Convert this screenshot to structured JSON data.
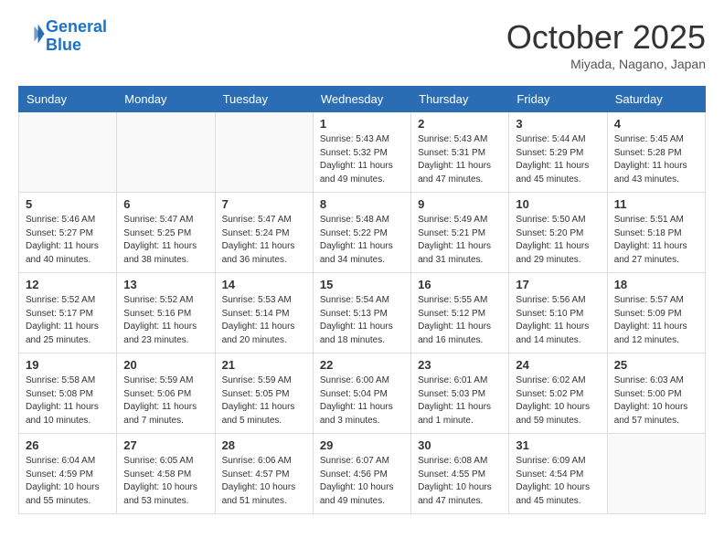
{
  "header": {
    "logo_line1": "General",
    "logo_line2": "Blue",
    "month": "October 2025",
    "location": "Miyada, Nagano, Japan"
  },
  "weekdays": [
    "Sunday",
    "Monday",
    "Tuesday",
    "Wednesday",
    "Thursday",
    "Friday",
    "Saturday"
  ],
  "weeks": [
    [
      {
        "day": "",
        "info": ""
      },
      {
        "day": "",
        "info": ""
      },
      {
        "day": "",
        "info": ""
      },
      {
        "day": "1",
        "info": "Sunrise: 5:43 AM\nSunset: 5:32 PM\nDaylight: 11 hours\nand 49 minutes."
      },
      {
        "day": "2",
        "info": "Sunrise: 5:43 AM\nSunset: 5:31 PM\nDaylight: 11 hours\nand 47 minutes."
      },
      {
        "day": "3",
        "info": "Sunrise: 5:44 AM\nSunset: 5:29 PM\nDaylight: 11 hours\nand 45 minutes."
      },
      {
        "day": "4",
        "info": "Sunrise: 5:45 AM\nSunset: 5:28 PM\nDaylight: 11 hours\nand 43 minutes."
      }
    ],
    [
      {
        "day": "5",
        "info": "Sunrise: 5:46 AM\nSunset: 5:27 PM\nDaylight: 11 hours\nand 40 minutes."
      },
      {
        "day": "6",
        "info": "Sunrise: 5:47 AM\nSunset: 5:25 PM\nDaylight: 11 hours\nand 38 minutes."
      },
      {
        "day": "7",
        "info": "Sunrise: 5:47 AM\nSunset: 5:24 PM\nDaylight: 11 hours\nand 36 minutes."
      },
      {
        "day": "8",
        "info": "Sunrise: 5:48 AM\nSunset: 5:22 PM\nDaylight: 11 hours\nand 34 minutes."
      },
      {
        "day": "9",
        "info": "Sunrise: 5:49 AM\nSunset: 5:21 PM\nDaylight: 11 hours\nand 31 minutes."
      },
      {
        "day": "10",
        "info": "Sunrise: 5:50 AM\nSunset: 5:20 PM\nDaylight: 11 hours\nand 29 minutes."
      },
      {
        "day": "11",
        "info": "Sunrise: 5:51 AM\nSunset: 5:18 PM\nDaylight: 11 hours\nand 27 minutes."
      }
    ],
    [
      {
        "day": "12",
        "info": "Sunrise: 5:52 AM\nSunset: 5:17 PM\nDaylight: 11 hours\nand 25 minutes."
      },
      {
        "day": "13",
        "info": "Sunrise: 5:52 AM\nSunset: 5:16 PM\nDaylight: 11 hours\nand 23 minutes."
      },
      {
        "day": "14",
        "info": "Sunrise: 5:53 AM\nSunset: 5:14 PM\nDaylight: 11 hours\nand 20 minutes."
      },
      {
        "day": "15",
        "info": "Sunrise: 5:54 AM\nSunset: 5:13 PM\nDaylight: 11 hours\nand 18 minutes."
      },
      {
        "day": "16",
        "info": "Sunrise: 5:55 AM\nSunset: 5:12 PM\nDaylight: 11 hours\nand 16 minutes."
      },
      {
        "day": "17",
        "info": "Sunrise: 5:56 AM\nSunset: 5:10 PM\nDaylight: 11 hours\nand 14 minutes."
      },
      {
        "day": "18",
        "info": "Sunrise: 5:57 AM\nSunset: 5:09 PM\nDaylight: 11 hours\nand 12 minutes."
      }
    ],
    [
      {
        "day": "19",
        "info": "Sunrise: 5:58 AM\nSunset: 5:08 PM\nDaylight: 11 hours\nand 10 minutes."
      },
      {
        "day": "20",
        "info": "Sunrise: 5:59 AM\nSunset: 5:06 PM\nDaylight: 11 hours\nand 7 minutes."
      },
      {
        "day": "21",
        "info": "Sunrise: 5:59 AM\nSunset: 5:05 PM\nDaylight: 11 hours\nand 5 minutes."
      },
      {
        "day": "22",
        "info": "Sunrise: 6:00 AM\nSunset: 5:04 PM\nDaylight: 11 hours\nand 3 minutes."
      },
      {
        "day": "23",
        "info": "Sunrise: 6:01 AM\nSunset: 5:03 PM\nDaylight: 11 hours\nand 1 minute."
      },
      {
        "day": "24",
        "info": "Sunrise: 6:02 AM\nSunset: 5:02 PM\nDaylight: 10 hours\nand 59 minutes."
      },
      {
        "day": "25",
        "info": "Sunrise: 6:03 AM\nSunset: 5:00 PM\nDaylight: 10 hours\nand 57 minutes."
      }
    ],
    [
      {
        "day": "26",
        "info": "Sunrise: 6:04 AM\nSunset: 4:59 PM\nDaylight: 10 hours\nand 55 minutes."
      },
      {
        "day": "27",
        "info": "Sunrise: 6:05 AM\nSunset: 4:58 PM\nDaylight: 10 hours\nand 53 minutes."
      },
      {
        "day": "28",
        "info": "Sunrise: 6:06 AM\nSunset: 4:57 PM\nDaylight: 10 hours\nand 51 minutes."
      },
      {
        "day": "29",
        "info": "Sunrise: 6:07 AM\nSunset: 4:56 PM\nDaylight: 10 hours\nand 49 minutes."
      },
      {
        "day": "30",
        "info": "Sunrise: 6:08 AM\nSunset: 4:55 PM\nDaylight: 10 hours\nand 47 minutes."
      },
      {
        "day": "31",
        "info": "Sunrise: 6:09 AM\nSunset: 4:54 PM\nDaylight: 10 hours\nand 45 minutes."
      },
      {
        "day": "",
        "info": ""
      }
    ]
  ]
}
